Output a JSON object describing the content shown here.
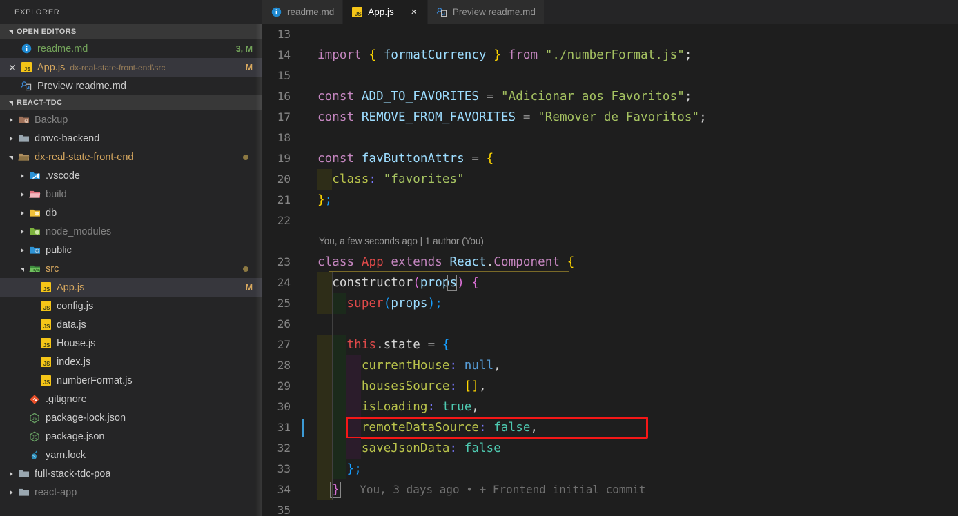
{
  "sidebar": {
    "title": "EXPLORER",
    "open_editors": {
      "header": "OPEN EDITORS",
      "items": [
        {
          "name": "readme.md",
          "sub": "",
          "badge": "3, M",
          "icon": "info-icon",
          "close": false,
          "color": "#73a35a"
        },
        {
          "name": "App.js",
          "sub": "dx-real-state-front-end\\src",
          "badge": "M",
          "icon": "js-icon",
          "close": true,
          "color": "#d7a85f"
        },
        {
          "name": "Preview readme.md",
          "sub": "",
          "badge": "",
          "icon": "preview-icon",
          "close": false,
          "color": "#cccccc"
        }
      ]
    },
    "workspace": {
      "header": "REACT-TDC",
      "tree": [
        {
          "label": "Backup",
          "depth": 1,
          "type": "folder",
          "state": "collapsed",
          "icon": "folder-backup-icon",
          "dim": true
        },
        {
          "label": "dmvc-backend",
          "depth": 1,
          "type": "folder",
          "state": "collapsed",
          "icon": "folder-icon",
          "dim": false
        },
        {
          "label": "dx-real-state-front-end",
          "depth": 1,
          "type": "folder",
          "state": "expanded",
          "icon": "folder-open-icon",
          "dim": false,
          "modified": true,
          "color": "#d7a85f"
        },
        {
          "label": ".vscode",
          "depth": 2,
          "type": "folder",
          "state": "collapsed",
          "icon": "folder-vscode-icon",
          "dim": false
        },
        {
          "label": "build",
          "depth": 2,
          "type": "folder",
          "state": "collapsed",
          "icon": "folder-build-icon",
          "dim": true
        },
        {
          "label": "db",
          "depth": 2,
          "type": "folder",
          "state": "collapsed",
          "icon": "folder-db-icon",
          "dim": false
        },
        {
          "label": "node_modules",
          "depth": 2,
          "type": "folder",
          "state": "collapsed",
          "icon": "folder-node-icon",
          "dim": true
        },
        {
          "label": "public",
          "depth": 2,
          "type": "folder",
          "state": "collapsed",
          "icon": "folder-public-icon",
          "dim": false
        },
        {
          "label": "src",
          "depth": 2,
          "type": "folder",
          "state": "expanded",
          "icon": "folder-src-icon",
          "dim": false,
          "modified": true,
          "color": "#d7a85f"
        },
        {
          "label": "App.js",
          "depth": 3,
          "type": "file",
          "icon": "js-icon",
          "selected": true,
          "badge": "M",
          "color": "#d7a85f"
        },
        {
          "label": "config.js",
          "depth": 3,
          "type": "file",
          "icon": "js-icon"
        },
        {
          "label": "data.js",
          "depth": 3,
          "type": "file",
          "icon": "js-icon"
        },
        {
          "label": "House.js",
          "depth": 3,
          "type": "file",
          "icon": "js-icon"
        },
        {
          "label": "index.js",
          "depth": 3,
          "type": "file",
          "icon": "js-icon"
        },
        {
          "label": "numberFormat.js",
          "depth": 3,
          "type": "file",
          "icon": "js-icon"
        },
        {
          "label": ".gitignore",
          "depth": 2,
          "type": "file",
          "icon": "git-icon"
        },
        {
          "label": "package-lock.json",
          "depth": 2,
          "type": "file",
          "icon": "node-icon"
        },
        {
          "label": "package.json",
          "depth": 2,
          "type": "file",
          "icon": "node-icon"
        },
        {
          "label": "yarn.lock",
          "depth": 2,
          "type": "file",
          "icon": "yarn-icon"
        },
        {
          "label": "full-stack-tdc-poa",
          "depth": 1,
          "type": "folder",
          "state": "collapsed",
          "icon": "folder-icon",
          "dim": false
        },
        {
          "label": "react-app",
          "depth": 1,
          "type": "folder",
          "state": "collapsed",
          "icon": "folder-icon",
          "dim": true
        }
      ]
    }
  },
  "tabs": [
    {
      "label": "readme.md",
      "icon": "info-icon",
      "active": false,
      "close": false
    },
    {
      "label": "App.js",
      "icon": "js-icon",
      "active": true,
      "close": true,
      "close_label": "×"
    },
    {
      "label": "Preview readme.md",
      "icon": "preview-icon",
      "active": false,
      "close": false
    }
  ],
  "editor": {
    "language": "javascript",
    "file": "App.js",
    "first_visible_line": 13,
    "cursor_line": 31,
    "codelens": "You, a few seconds ago | 1 author (You)",
    "codelens_line": 23,
    "blame": "You, 3 days ago • + Frontend initial commit",
    "blame_line": 34,
    "highlight_box": {
      "line": 31,
      "color": "#f51717"
    },
    "lines": [
      {
        "n": 13,
        "text": ""
      },
      {
        "n": 14,
        "text": "import { formatCurrency } from \"./numberFormat.js\";"
      },
      {
        "n": 15,
        "text": ""
      },
      {
        "n": 16,
        "text": "const ADD_TO_FAVORITES = \"Adicionar aos Favoritos\";"
      },
      {
        "n": 17,
        "text": "const REMOVE_FROM_FAVORITES = \"Remover de Favoritos\";"
      },
      {
        "n": 18,
        "text": ""
      },
      {
        "n": 19,
        "text": "const favButtonAttrs = {"
      },
      {
        "n": 20,
        "text": "  class: \"favorites\""
      },
      {
        "n": 21,
        "text": "};"
      },
      {
        "n": 22,
        "text": ""
      },
      {
        "n": 23,
        "text": "class App extends React.Component {"
      },
      {
        "n": 24,
        "text": "  constructor(props) {"
      },
      {
        "n": 25,
        "text": "    super(props);"
      },
      {
        "n": 26,
        "text": ""
      },
      {
        "n": 27,
        "text": "    this.state = {"
      },
      {
        "n": 28,
        "text": "      currentHouse: null,"
      },
      {
        "n": 29,
        "text": "      housesSource: [],"
      },
      {
        "n": 30,
        "text": "      isLoading: true,"
      },
      {
        "n": 31,
        "text": "      remoteDataSource: false,"
      },
      {
        "n": 32,
        "text": "      saveJsonData: false"
      },
      {
        "n": 33,
        "text": "    };"
      },
      {
        "n": 34,
        "text": "  }"
      },
      {
        "n": 35,
        "text": ""
      }
    ]
  },
  "colors": {
    "editor_bg": "#1e1e1e",
    "sidebar_bg": "#252526",
    "tab_active_bg": "#1e1e1e",
    "tab_inactive_bg": "#2d2d2d",
    "selection_bg": "#37373d",
    "accent_red": "#f51717",
    "cursor": "#3c9bd6",
    "modified_badge": "#d7a85f",
    "added_badge": "#73a35a"
  }
}
